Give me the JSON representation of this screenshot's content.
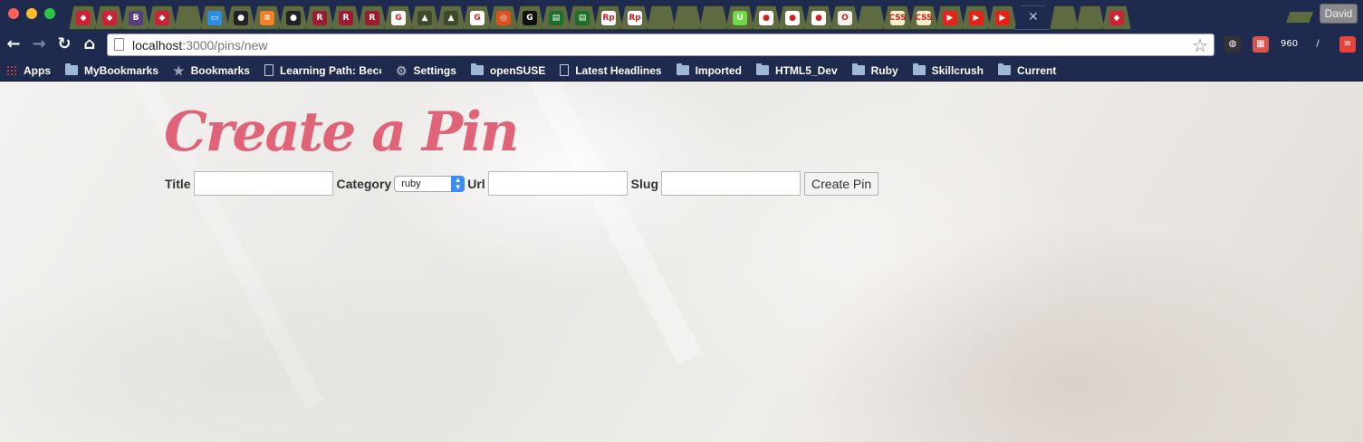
{
  "window": {
    "profile_name": "David",
    "tabs": [
      {
        "icon": "ruby-gem-icon",
        "color": "#cc2233",
        "glyph": "◆"
      },
      {
        "icon": "ruby-gem-icon",
        "color": "#cc2233",
        "glyph": "◆"
      },
      {
        "icon": "bootstrap-icon",
        "color": "#563d7c",
        "glyph": "B"
      },
      {
        "icon": "ruby-gem-icon",
        "color": "#cc2233",
        "glyph": "◆"
      },
      {
        "icon": "blank-page-icon",
        "color": "#5e6a3f",
        "glyph": ""
      },
      {
        "icon": "chat-icon",
        "color": "#2d8ee8",
        "glyph": "▭"
      },
      {
        "icon": "github-icon",
        "color": "#222222",
        "glyph": "●"
      },
      {
        "icon": "stack-overflow-icon",
        "color": "#f48024",
        "glyph": "≡"
      },
      {
        "icon": "github-icon",
        "color": "#222222",
        "glyph": "●"
      },
      {
        "icon": "railscasts-icon",
        "color": "#9b1b30",
        "glyph": "R"
      },
      {
        "icon": "railscasts-icon",
        "color": "#9b1b30",
        "glyph": "R"
      },
      {
        "icon": "railscasts-icon",
        "color": "#9b1b30",
        "glyph": "R"
      },
      {
        "icon": "google-icon",
        "color": "#ffffff",
        "glyph": "G"
      },
      {
        "icon": "tree-icon",
        "color": "#3d4a2a",
        "glyph": "▲"
      },
      {
        "icon": "tree-icon",
        "color": "#3d4a2a",
        "glyph": "▲"
      },
      {
        "icon": "google-icon",
        "color": "#ffffff",
        "glyph": "G"
      },
      {
        "icon": "search-target-icon",
        "color": "#e0501f",
        "glyph": "◎"
      },
      {
        "icon": "g-circle-icon",
        "color": "#111111",
        "glyph": "G"
      },
      {
        "icon": "terminal-icon",
        "color": "#1b6e2b",
        "glyph": "▤"
      },
      {
        "icon": "terminal-icon",
        "color": "#1b6e2b",
        "glyph": "▤"
      },
      {
        "icon": "rp-icon",
        "color": "#ffffff",
        "glyph": "Rp"
      },
      {
        "icon": "rp-icon",
        "color": "#ffffff",
        "glyph": "Rp"
      },
      {
        "icon": "blank-page-icon",
        "color": "#5e6a3f",
        "glyph": ""
      },
      {
        "icon": "blank-page-icon",
        "color": "#5e6a3f",
        "glyph": ""
      },
      {
        "icon": "blank-page-icon",
        "color": "#5e6a3f",
        "glyph": ""
      },
      {
        "icon": "upwork-icon",
        "color": "#6fda44",
        "glyph": "U"
      },
      {
        "icon": "panda-icon",
        "color": "#ffffff",
        "glyph": "●"
      },
      {
        "icon": "panda-icon",
        "color": "#ffffff",
        "glyph": "●"
      },
      {
        "icon": "panda-icon",
        "color": "#ffffff",
        "glyph": "●"
      },
      {
        "icon": "o-letter-icon",
        "color": "#eeeeee",
        "glyph": "O"
      },
      {
        "icon": "blank-page-icon",
        "color": "#5e6a3f",
        "glyph": ""
      },
      {
        "icon": "css-icon",
        "color": "#f4f0c8",
        "glyph": "CSS"
      },
      {
        "icon": "css-icon",
        "color": "#f4f0c8",
        "glyph": "CSS"
      },
      {
        "icon": "youtube-icon",
        "color": "#e62117",
        "glyph": "▶"
      },
      {
        "icon": "youtube-icon",
        "color": "#e62117",
        "glyph": "▶"
      },
      {
        "icon": "youtube-icon",
        "color": "#e62117",
        "glyph": "▶"
      },
      {
        "icon": "close-icon",
        "color": "#1f2a4f",
        "glyph": "✕",
        "active": true
      },
      {
        "icon": "blank-page-icon",
        "color": "#5e6a3f",
        "glyph": ""
      },
      {
        "icon": "blank-page-icon",
        "color": "#5e6a3f",
        "glyph": ""
      },
      {
        "icon": "ruby-gem-icon",
        "color": "#cc2233",
        "glyph": "◆"
      }
    ]
  },
  "toolbar": {
    "url_host": "localhost",
    "url_rest": ":3000/pins/new",
    "extensions": [
      {
        "icon": "spy-extension-icon",
        "color": "#333333",
        "glyph": "◍"
      },
      {
        "icon": "film-extension-icon",
        "color": "#d9534f",
        "glyph": "▦"
      },
      {
        "icon": "960-grid-extension-icon",
        "color": "#1f2a4f",
        "glyph": "960"
      },
      {
        "icon": "color-picker-extension-icon",
        "color": "#1f2a4f",
        "glyph": "∕"
      },
      {
        "icon": "menu-extension-icon",
        "color": "#e8443a",
        "glyph": "≡"
      }
    ]
  },
  "bookmarks": [
    {
      "label": "Apps",
      "icon": "apps-grid-icon"
    },
    {
      "label": "MyBookmarks",
      "icon": "folder-icon"
    },
    {
      "label": "Bookmarks",
      "icon": "star-icon"
    },
    {
      "label": "Learning Path: Becon",
      "icon": "page-icon"
    },
    {
      "label": "Settings",
      "icon": "gear-icon"
    },
    {
      "label": "openSUSE",
      "icon": "folder-icon"
    },
    {
      "label": "Latest Headlines",
      "icon": "page-icon"
    },
    {
      "label": "Imported",
      "icon": "folder-icon"
    },
    {
      "label": "HTML5_Dev",
      "icon": "folder-icon"
    },
    {
      "label": "Ruby",
      "icon": "folder-icon"
    },
    {
      "label": "Skillcrush",
      "icon": "folder-icon"
    },
    {
      "label": "Current",
      "icon": "folder-icon"
    }
  ],
  "page": {
    "title": "Create a Pin",
    "title_color": "#e06377",
    "form": {
      "title_label": "Title",
      "title_value": "",
      "category_label": "Category",
      "category_selected": "ruby",
      "url_label": "Url",
      "url_value": "",
      "slug_label": "Slug",
      "slug_value": "",
      "submit_label": "Create Pin"
    }
  }
}
